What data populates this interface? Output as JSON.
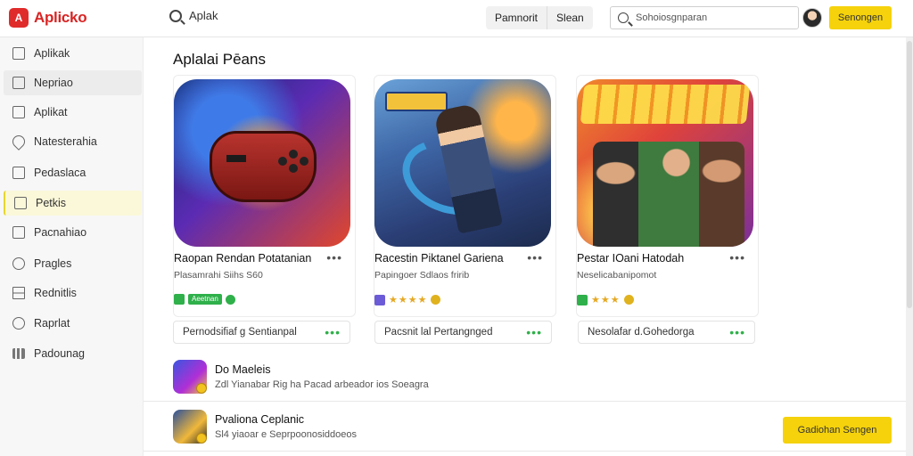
{
  "app": {
    "logo_glyph": "A",
    "name": "Aplicko",
    "search_query": "Aplak"
  },
  "header": {
    "tabs": [
      "Pamnorit",
      "Slean"
    ],
    "search_placeholder": "Sohoiosgnparan",
    "cta_label": "Senongen"
  },
  "sidebar": {
    "items": [
      {
        "label": "Aplikak",
        "icon": "app-icon"
      },
      {
        "label": "Nepriao",
        "icon": "image-icon"
      },
      {
        "label": "Aplikat",
        "icon": "square-icon"
      },
      {
        "label": "Natesterahia",
        "icon": "location-icon"
      },
      {
        "label": "Pedaslaca",
        "icon": "document-icon"
      },
      {
        "label": "Petkis",
        "icon": "app-icon"
      },
      {
        "label": "Pacnahiao",
        "icon": "square-icon"
      },
      {
        "label": "Pragles",
        "icon": "circle-icon"
      },
      {
        "label": "Rednitlis",
        "icon": "grid-icon"
      },
      {
        "label": "Raprlat",
        "icon": "pin-icon"
      },
      {
        "label": "Padounag",
        "icon": "bars-icon"
      }
    ],
    "active_index": 5,
    "hover_index": 1
  },
  "main": {
    "section_title": "Aplalai Pēans",
    "cards": [
      {
        "title": "Raopan Rendan Potatanian",
        "subtitle": "Plasamrahi Siihs S60",
        "badge_text": "Aeetnan",
        "footer": "Pernodsifiaf g Sentianpal",
        "rating": 0
      },
      {
        "title": "Racestin Piktanel Gariena",
        "subtitle": "Papingoer Sdlaos fririb",
        "stars": "★★★★",
        "footer": "Pacsnit lal Pertangnged",
        "rating": 4
      },
      {
        "title": "Pestar IOani Hatodah",
        "subtitle": "Neselicabanipomot",
        "stars": "★★★",
        "footer": "Nesolafar d.Gohedorga",
        "rating": 3
      }
    ],
    "list": [
      {
        "title": "Do Maeleis",
        "subtitle": "Zdl Yianabar Rig ha Pacad arbeador ios Soeagra"
      },
      {
        "title": "Pvaliona Ceplanic",
        "subtitle": "Sl4 yiaoar e Seprpoonosiddoeos"
      }
    ],
    "bottom_cta": "Gadiohan Sengen"
  },
  "colors": {
    "brand_red": "#d92424",
    "accent_yellow": "#f5d20c",
    "success_green": "#2fb04a",
    "star_gold": "#e5a823"
  }
}
